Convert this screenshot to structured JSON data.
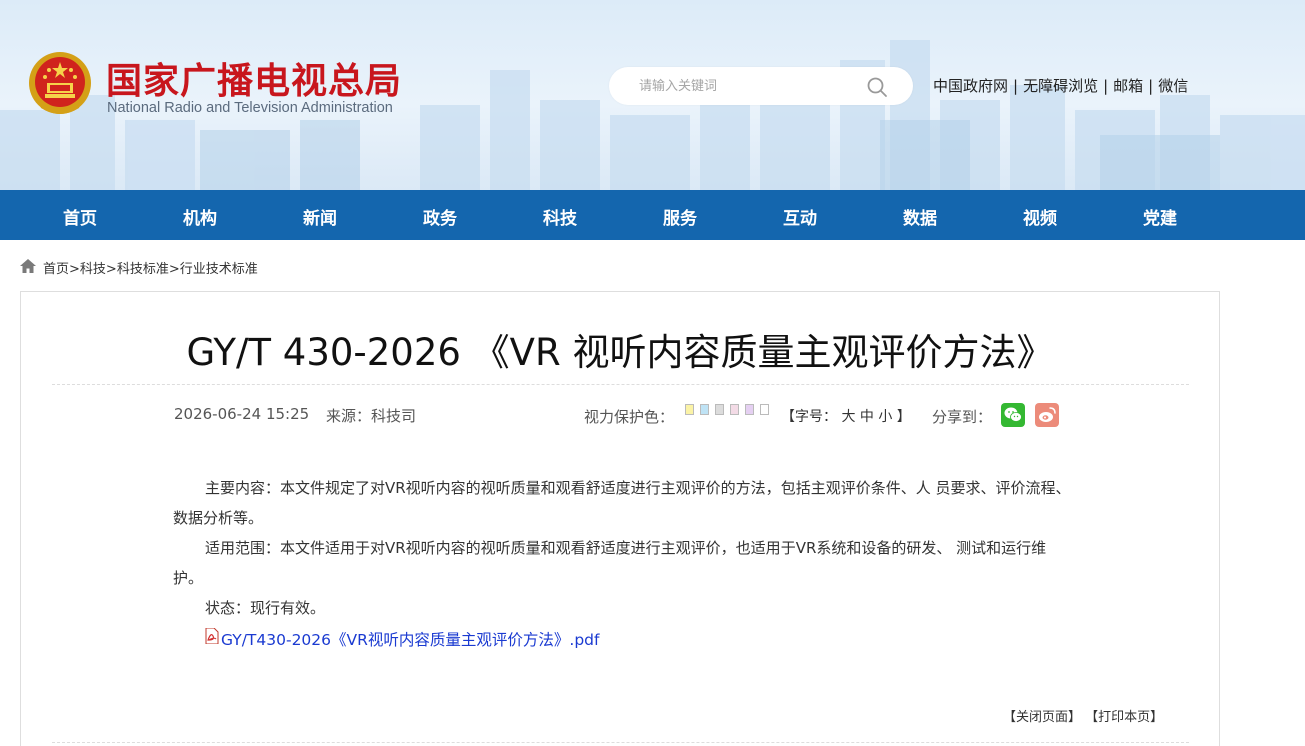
{
  "header": {
    "title": "国家广播电视总局",
    "subtitle": "National Radio and Television Administration",
    "search_placeholder": "请输入关键词",
    "top_links": [
      "中国政府网",
      "无障碍浏览",
      "邮箱",
      "微信"
    ],
    "separator": "|"
  },
  "nav": {
    "items": [
      "首页",
      "机构",
      "新闻",
      "政务",
      "科技",
      "服务",
      "互动",
      "数据",
      "视频",
      "党建"
    ]
  },
  "breadcrumb": {
    "items": [
      "首页>",
      "科技>",
      "科技标准>",
      "行业技术标准"
    ]
  },
  "article": {
    "title": "GY/T 430-2026 《VR 视听内容质量主观评价方法》",
    "date": "2026-06-24 15:25",
    "source": "来源：科技司",
    "eye_protect_label": "视力保护色：",
    "eye_colors": [
      "#fbf3a6",
      "#bfe3f5",
      "#dcdcdc",
      "#f3dbe6",
      "#e5d0f2",
      "#ffffff"
    ],
    "font_size_label": "【字号： 大 中 小 】",
    "share_label": "分享到：",
    "paragraphs": [
      "主要内容：本文件规定了对VR视听内容的视听质量和观看舒适度进行主观评价的方法，包括主观评价条件、人 员要求、评价流程、数据分析等。",
      "适用范围：本文件适用于对VR视听内容的视听质量和观看舒适度进行主观评价，也适用于VR系统和设备的研发、 测试和运行维护。",
      "状态：现行有效。"
    ],
    "attachment": "GY/T430-2026《VR视听内容质量主观评价方法》.pdf",
    "close_page": "【关闭页面】",
    "print_page": "【打印本页】"
  },
  "colors": {
    "nav_bg": "#1466ae",
    "title_red": "#c8161d",
    "link_blue": "#1a3ad1",
    "wechat_green": "#34b832",
    "weibo_orange": "#ec8b7a"
  }
}
